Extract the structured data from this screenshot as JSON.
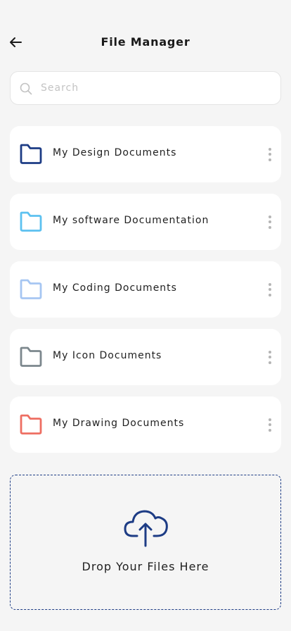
{
  "header": {
    "title": "File Manager",
    "back_icon": "arrow-left-icon"
  },
  "search": {
    "placeholder": "Search",
    "value": "",
    "icon": "search-icon"
  },
  "folders": [
    {
      "name": "My Design Documents",
      "color": "#1d3c85",
      "icon": "folder-icon"
    },
    {
      "name": "My software Documentation",
      "color": "#5cc1f0",
      "icon": "folder-icon"
    },
    {
      "name": "My Coding Documents",
      "color": "#a6c6f2",
      "icon": "folder-icon"
    },
    {
      "name": "My Icon Documents",
      "color": "#7c878d",
      "icon": "folder-icon"
    },
    {
      "name": "My Drawing Documents",
      "color": "#ee6e62",
      "icon": "folder-icon"
    }
  ],
  "dropzone": {
    "label": "Drop Your Files Here",
    "icon": "cloud-upload-icon",
    "accent": "#1d3c85"
  }
}
